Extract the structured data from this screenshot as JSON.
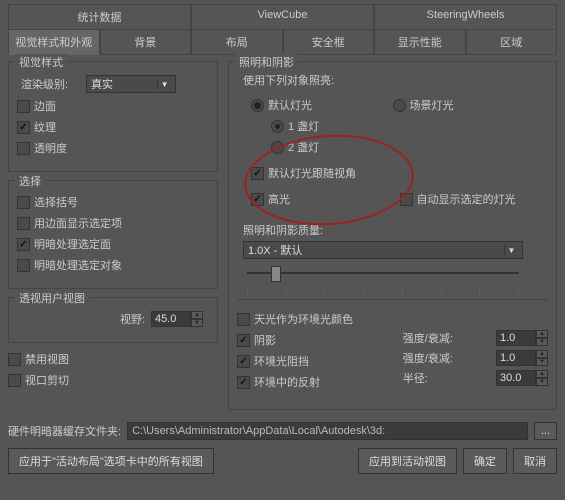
{
  "tabs_top": {
    "t1": "统计数据",
    "t2": "ViewCube",
    "t3": "SteeringWheels"
  },
  "tabs_bot": {
    "t1": "视觉样式和外观",
    "t2": "背景",
    "t3": "布局",
    "t4": "安全框",
    "t5": "显示性能",
    "t6": "区域"
  },
  "left": {
    "visual_style_title": "视觉样式",
    "render_level_lbl": "渲染级别:",
    "render_level_val": "真实",
    "face": "边面",
    "texture": "纹理",
    "transparency": "透明度",
    "select_title": "选择",
    "sel_bracket": "选择括号",
    "sel_edge": "用边面显示选定项",
    "sel_shade_face": "明暗处理选定面",
    "sel_shade_obj": "明暗处理选定对象",
    "persp_title": "透视用户视图",
    "fov_lbl": "视野:",
    "fov_val": "45.0",
    "disable_view": "禁用视图",
    "viewport_clip": "视口剪切"
  },
  "right": {
    "light_title": "照明和阴影",
    "use_light_lbl": "使用下列对象照亮:",
    "default_light": "默认灯光",
    "one_light": "1 盏灯",
    "two_light": "2 盏灯",
    "scene_light": "场景灯光",
    "track_view": "默认灯光跟随视角",
    "highlight": "高光",
    "auto_show_sel_light": "自动显示选定的灯光",
    "quality_lbl": "照明和阴影质量:",
    "quality_val": "1.0X - 默认",
    "sky_env": "天光作为环境光颜色",
    "shadow": "阴影",
    "ao": "环境光阻挡",
    "env_refl": "环境中的反射",
    "intensity_lbl": "强度/衰减:",
    "intensity_val1": "1.0",
    "intensity_val2": "1.0",
    "radius_lbl": "半径:",
    "radius_val": "30.0"
  },
  "buffer_lbl": "硬件明暗器缓存文件夹:",
  "buffer_path": "C:\\Users\\Administrator\\AppData\\Local\\Autodesk\\3d:",
  "ellipsis": "...",
  "apply_all": "应用于\"活动布局\"选项卡中的所有视图",
  "apply_active": "应用到活动视图",
  "ok": "确定",
  "cancel": "取消"
}
